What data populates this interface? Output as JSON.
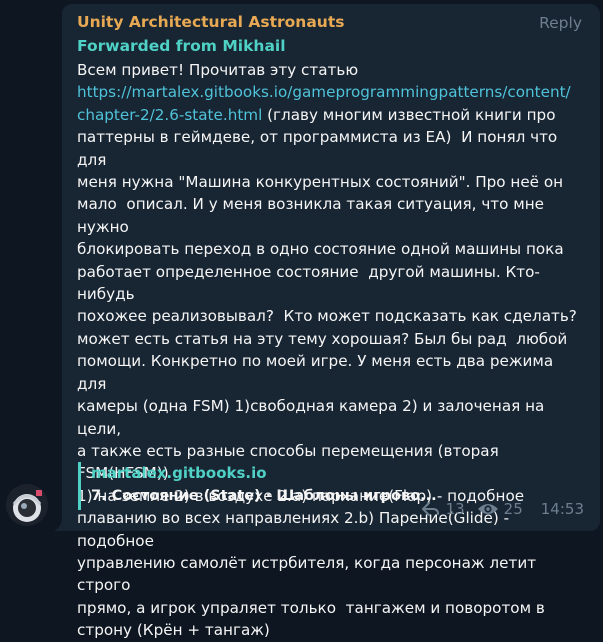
{
  "message": {
    "sender": "Unity Architectural Astronauts",
    "reply_label": "Reply",
    "forwarded_from": "Forwarded from Mikhail",
    "text_before_link": "Всем привет! Прочитав эту статью\n",
    "link": "https://martalex.gitbooks.io/gameprogrammingpatterns/content/\nchapter-2/2.6-state.html",
    "text_after_link": " (главу многим известной книги про\nпаттерны в геймдеве, от программиста из ЕА)  И понял что для\nменя нужна \"Машина конкурентных состояний\". Про неё он\nмало  описал. И у меня возникла такая ситуация, что мне нужно\nблокировать переход в одно состояние одной машины пока\nработает определенное состояние  другой машины. Кто-нибудь\nпохожее реализовывал?  Кто может подсказать как сделать?\nможет есть статья на эту тему хорошая? Был бы рад  любой\nпомощи. Конкретно по моей игре. У меня есть два режима для\nкамеры (одна FSM) 1)свободная камера 2) и залоченая на цели,\nа также есть разные способы перемещения (вторая FSM(HFSM))\n1) на земле 2) в воздухе 2.a) пархание(Flap) - подобное\nплаванию во всех направлениях 2.b) Парение(Glide) - подобное\nуправлению самолёт истрбителя, когда персонаж летит строго\nпрямо, а игрок упраляет только  тангажем и поворотом в\nстрону (Крён + тангаж)",
    "preview": {
      "site": "martalex.gitbooks.io",
      "title": "7. Состояние (State) · Шаблоны игрово..."
    },
    "replies_count": "13",
    "views_count": "25",
    "time": "14:53"
  },
  "colors": {
    "background": "#0e1621",
    "bubble": "#182533",
    "sender": "#e7a953",
    "accent": "#4fd1c5",
    "link": "#4fc3d9",
    "meta": "#6d7f8f"
  },
  "icons": {
    "reply_count": "reply-arrow-icon",
    "views": "eye-icon"
  }
}
